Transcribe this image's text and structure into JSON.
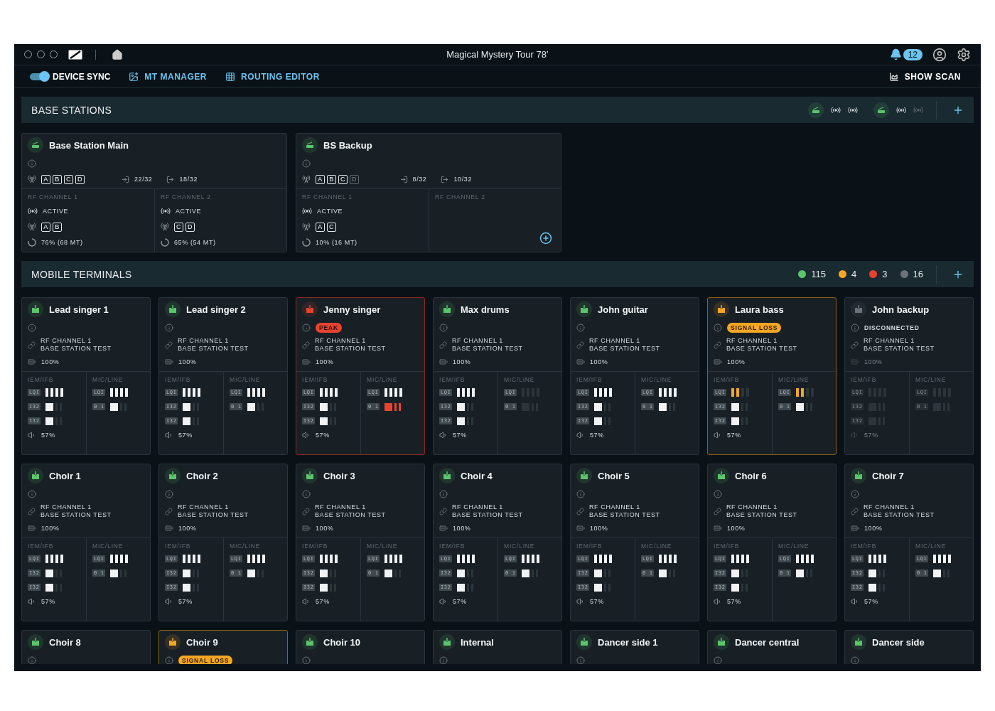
{
  "window": {
    "title": "Magical Mystery Tour 78’",
    "notifications": "12"
  },
  "toolbar": {
    "sync": {
      "label": "DEVICE SYNC",
      "on": true
    },
    "links": [
      {
        "label": "MT MANAGER",
        "kind": "manager"
      },
      {
        "label": "ROUTING EDITOR",
        "kind": "routing"
      }
    ],
    "scan": "SHOW SCAN"
  },
  "base_stations": {
    "title": "BASE STATIONS",
    "summary": [
      {
        "channels": [
          {
            "active": true
          },
          {
            "active": true
          }
        ]
      },
      {
        "channels": [
          {
            "active": true
          },
          {
            "active": false
          }
        ]
      }
    ],
    "stations": [
      {
        "name": "Base Station Main",
        "antennas": [
          {
            "label": "A",
            "enabled": true
          },
          {
            "label": "B",
            "enabled": true
          },
          {
            "label": "C",
            "enabled": true
          },
          {
            "label": "D",
            "enabled": true
          }
        ],
        "inputs": "22/32",
        "outputs": "18/32",
        "channels": [
          {
            "label": "RF CHANNEL 1",
            "state": "ACTIVE",
            "antennas": [
              "A",
              "B"
            ],
            "load": "76% (68 MT)"
          },
          {
            "label": "RF CHANNEL 2",
            "state": "ACTIVE",
            "antennas": [
              "C",
              "D"
            ],
            "load": "65% (54 MT)"
          }
        ]
      },
      {
        "name": "BS Backup",
        "antennas": [
          {
            "label": "A",
            "enabled": true
          },
          {
            "label": "B",
            "enabled": true
          },
          {
            "label": "C",
            "enabled": true
          },
          {
            "label": "D",
            "enabled": false
          }
        ],
        "inputs": "8/32",
        "outputs": "10/32",
        "channels": [
          {
            "label": "RF CHANNEL 1",
            "state": "ACTIVE",
            "antennas": [
              "A",
              "C"
            ],
            "load": "10% (16 MT)"
          },
          {
            "label": "RF CHANNEL 2"
          }
        ]
      }
    ]
  },
  "mobile_terminals": {
    "title": "MOBILE TERMINALS",
    "counts": [
      {
        "color": "#5cc46a",
        "count": "115"
      },
      {
        "color": "#f5a623",
        "count": "4"
      },
      {
        "color": "#e8432f",
        "count": "3"
      },
      {
        "color": "#6b7378",
        "count": "16"
      }
    ],
    "terminals": [
      {
        "name": "Lead singer 1",
        "kind": "ok",
        "channel": "RF CHANNEL 1",
        "station": "BASE STATION TEST",
        "battery": "100%",
        "iem": {
          "label": "IEM/IFB",
          "rows": [
            {
              "tag": "LQI",
              "kind": "lqi",
              "level": 1
            },
            {
              "tag": "I32",
              "kind": "meter",
              "level": 0.48
            },
            {
              "tag": "I32",
              "kind": "meter",
              "level": 0.48
            }
          ],
          "volume": "57%"
        },
        "mic": {
          "label": "MIC/LINE",
          "rows": [
            {
              "tag": "LQI",
              "kind": "lqi",
              "level": 1
            },
            {
              "tag": "0 1",
              "kind": "meter",
              "level": 0.48
            }
          ]
        }
      },
      {
        "name": "Lead singer 2",
        "kind": "ok",
        "channel": "RF CHANNEL 1",
        "station": "BASE STATION TEST",
        "battery": "100%",
        "iem": {
          "label": "IEM/IFB",
          "rows": [
            {
              "tag": "LQI",
              "kind": "lqi",
              "level": 1
            },
            {
              "tag": "I32",
              "kind": "meter",
              "level": 0.48
            },
            {
              "tag": "I32",
              "kind": "meter",
              "level": 0.48
            }
          ],
          "volume": "57%"
        },
        "mic": {
          "label": "MIC/LINE",
          "rows": [
            {
              "tag": "LQI",
              "kind": "lqi",
              "level": 1
            },
            {
              "tag": "0 1",
              "kind": "meter",
              "level": 0.48
            }
          ]
        }
      },
      {
        "name": "Jenny singer",
        "kind": "peak",
        "badge": "PEAK",
        "channel": "RF CHANNEL 1",
        "station": "BASE STATION TEST",
        "battery": "100%",
        "iem": {
          "label": "IEM/IFB",
          "rows": [
            {
              "tag": "LQI",
              "kind": "lqi",
              "level": 1
            },
            {
              "tag": "I32",
              "kind": "meter",
              "level": 0.48
            },
            {
              "tag": "I32",
              "kind": "meter",
              "level": 0.48
            }
          ],
          "volume": "57%"
        },
        "mic": {
          "label": "MIC/LINE",
          "rows": [
            {
              "tag": "LQI",
              "kind": "lqi",
              "level": 1
            },
            {
              "tag": "0 1",
              "kind": "meter",
              "level": 1
            }
          ]
        }
      },
      {
        "name": "Max drums",
        "kind": "ok",
        "channel": "RF CHANNEL 1",
        "station": "BASE STATION TEST",
        "battery": "100%",
        "iem": {
          "label": "IEM/IFB",
          "rows": [
            {
              "tag": "LQI",
              "kind": "lqi",
              "level": 1
            },
            {
              "tag": "I32",
              "kind": "meter",
              "level": 0.48
            },
            {
              "tag": "I32",
              "kind": "meter",
              "level": 0.48
            }
          ],
          "volume": "57%"
        },
        "mic": {
          "label": "MIC/LINE",
          "rows": [
            {
              "tag": "LQI",
              "kind": "lqi_off"
            },
            {
              "tag": "0 1",
              "kind": "meter_off"
            }
          ]
        }
      },
      {
        "name": "John guitar",
        "kind": "ok",
        "channel": "RF CHANNEL 1",
        "station": "BASE STATION TEST",
        "battery": "100%",
        "iem": {
          "label": "IEM/IFB",
          "rows": [
            {
              "tag": "LQI",
              "kind": "lqi",
              "level": 1
            },
            {
              "tag": "I32",
              "kind": "meter",
              "level": 0.48
            },
            {
              "tag": "I32",
              "kind": "meter",
              "level": 0.48
            }
          ],
          "volume": "57%"
        },
        "mic": {
          "label": "MIC/LINE",
          "rows": [
            {
              "tag": "LQI",
              "kind": "lqi",
              "level": 1
            },
            {
              "tag": "0 1",
              "kind": "meter",
              "level": 0.48
            }
          ]
        }
      },
      {
        "name": "Laura bass",
        "kind": "signal_loss",
        "badge": "SIGNAL LOSS",
        "channel": "RF CHANNEL 1",
        "station": "BASE STATION TEST",
        "battery": "100%",
        "iem": {
          "label": "IEM/IFB",
          "rows": [
            {
              "tag": "LQI",
              "kind": "lqi",
              "level": 0.5
            },
            {
              "tag": "I32",
              "kind": "meter",
              "level": 0.48
            },
            {
              "tag": "I32",
              "kind": "meter",
              "level": 0.48
            }
          ],
          "volume": "57%"
        },
        "mic": {
          "label": "MIC/LINE",
          "rows": [
            {
              "tag": "LQI",
              "kind": "lqi",
              "level": 0.5
            },
            {
              "tag": "0 1",
              "kind": "meter",
              "level": 0.48
            }
          ]
        }
      },
      {
        "name": "John backup",
        "kind": "disconnected",
        "badge": "DISCONNECTED",
        "channel": "RF CHANNEL 1",
        "station": "BASE STATION TEST",
        "battery": "100%",
        "iem": {
          "label": "IEM/IFB",
          "rows": [
            {
              "tag": "LQI",
              "kind": "lqi_off"
            },
            {
              "tag": "I32",
              "kind": "meter_off"
            },
            {
              "tag": "I32",
              "kind": "meter_off"
            }
          ],
          "volume": "57%"
        },
        "mic": {
          "label": "MIC/LINE",
          "rows": [
            {
              "tag": "LQI",
              "kind": "lqi_off"
            },
            {
              "tag": "0 1",
              "kind": "meter_off"
            }
          ]
        }
      },
      {
        "name": "Choir 1",
        "kind": "ok",
        "channel": "RF CHANNEL 1",
        "station": "BASE STATION TEST",
        "battery": "100%",
        "iem": {
          "label": "IEM/IFB",
          "rows": [
            {
              "tag": "LQI",
              "kind": "lqi",
              "level": 1
            },
            {
              "tag": "I32",
              "kind": "meter",
              "level": 0.48
            },
            {
              "tag": "I32",
              "kind": "meter",
              "level": 0.48
            }
          ],
          "volume": "57%"
        },
        "mic": {
          "label": "MIC/LINE",
          "rows": [
            {
              "tag": "LQI",
              "kind": "lqi",
              "level": 1
            },
            {
              "tag": "0 1",
              "kind": "meter",
              "level": 0.48
            }
          ]
        }
      },
      {
        "name": "Choir 2",
        "kind": "ok",
        "channel": "RF CHANNEL 1",
        "station": "BASE STATION TEST",
        "battery": "100%",
        "iem": {
          "label": "IEM/IFB",
          "rows": [
            {
              "tag": "LQI",
              "kind": "lqi",
              "level": 1
            },
            {
              "tag": "I32",
              "kind": "meter",
              "level": 0.48
            },
            {
              "tag": "I32",
              "kind": "meter",
              "level": 0.48
            }
          ],
          "volume": "57%"
        },
        "mic": {
          "label": "MIC/LINE",
          "rows": [
            {
              "tag": "LQI",
              "kind": "lqi",
              "level": 1
            },
            {
              "tag": "0 1",
              "kind": "meter",
              "level": 0.48
            }
          ]
        }
      },
      {
        "name": "Choir 3",
        "kind": "ok",
        "channel": "RF CHANNEL 1",
        "station": "BASE STATION TEST",
        "battery": "100%",
        "iem": {
          "label": "IEM/IFB",
          "rows": [
            {
              "tag": "LQI",
              "kind": "lqi",
              "level": 1
            },
            {
              "tag": "I32",
              "kind": "meter",
              "level": 0.48
            },
            {
              "tag": "I32",
              "kind": "meter",
              "level": 0.48
            }
          ],
          "volume": "57%"
        },
        "mic": {
          "label": "MIC/LINE",
          "rows": [
            {
              "tag": "LQI",
              "kind": "lqi",
              "level": 1
            },
            {
              "tag": "0 1",
              "kind": "meter",
              "level": 0.48
            }
          ]
        }
      },
      {
        "name": "Choir 4",
        "kind": "ok",
        "channel": "RF CHANNEL 1",
        "station": "BASE STATION TEST",
        "battery": "100%",
        "iem": {
          "label": "IEM/IFB",
          "rows": [
            {
              "tag": "LQI",
              "kind": "lqi",
              "level": 1
            },
            {
              "tag": "I32",
              "kind": "meter",
              "level": 0.48
            },
            {
              "tag": "I32",
              "kind": "meter",
              "level": 0.48
            }
          ],
          "volume": "57%"
        },
        "mic": {
          "label": "MIC/LINE",
          "rows": [
            {
              "tag": "LQI",
              "kind": "lqi",
              "level": 1
            },
            {
              "tag": "0 1",
              "kind": "meter",
              "level": 0.48
            }
          ]
        }
      },
      {
        "name": "Choir 5",
        "kind": "ok",
        "channel": "RF CHANNEL 1",
        "station": "BASE STATION TEST",
        "battery": "100%",
        "iem": {
          "label": "IEM/IFB",
          "rows": [
            {
              "tag": "LQI",
              "kind": "lqi",
              "level": 1
            },
            {
              "tag": "I32",
              "kind": "meter",
              "level": 0.48
            },
            {
              "tag": "I32",
              "kind": "meter",
              "level": 0.48
            }
          ],
          "volume": "57%"
        },
        "mic": {
          "label": "MIC/LINE",
          "rows": [
            {
              "tag": "LQI",
              "kind": "lqi",
              "level": 1
            },
            {
              "tag": "0 1",
              "kind": "meter",
              "level": 0.48
            }
          ]
        }
      },
      {
        "name": "Choir 6",
        "kind": "ok",
        "channel": "RF CHANNEL 1",
        "station": "BASE STATION TEST",
        "battery": "100%",
        "iem": {
          "label": "IEM/IFB",
          "rows": [
            {
              "tag": "LQI",
              "kind": "lqi",
              "level": 1
            },
            {
              "tag": "I32",
              "kind": "meter",
              "level": 0.48
            },
            {
              "tag": "I32",
              "kind": "meter",
              "level": 0.48
            }
          ],
          "volume": "57%"
        },
        "mic": {
          "label": "MIC/LINE",
          "rows": [
            {
              "tag": "LQI",
              "kind": "lqi",
              "level": 1
            },
            {
              "tag": "0 1",
              "kind": "meter",
              "level": 0.48
            }
          ]
        }
      },
      {
        "name": "Choir 7",
        "kind": "ok",
        "channel": "RF CHANNEL 1",
        "station": "BASE STATION TEST",
        "battery": "100%",
        "iem": {
          "label": "IEM/IFB",
          "rows": [
            {
              "tag": "LQI",
              "kind": "lqi",
              "level": 1
            },
            {
              "tag": "I32",
              "kind": "meter",
              "level": 0.48
            },
            {
              "tag": "I32",
              "kind": "meter",
              "level": 0.48
            }
          ],
          "volume": "57%"
        },
        "mic": {
          "label": "MIC/LINE",
          "rows": [
            {
              "tag": "LQI",
              "kind": "lqi",
              "level": 1
            },
            {
              "tag": "0 1",
              "kind": "meter",
              "level": 0.48
            }
          ]
        }
      },
      {
        "name": "Choir 8",
        "kind": "ok"
      },
      {
        "name": "Choir 9",
        "kind": "signal_loss",
        "badge": "SIGNAL LOSS"
      },
      {
        "name": "Choir 10",
        "kind": "ok"
      },
      {
        "name": "Internal",
        "kind": "ok"
      },
      {
        "name": "Dancer side 1",
        "kind": "ok"
      },
      {
        "name": "Dancer central",
        "kind": "ok"
      },
      {
        "name": "Dancer side",
        "kind": "ok"
      }
    ]
  }
}
